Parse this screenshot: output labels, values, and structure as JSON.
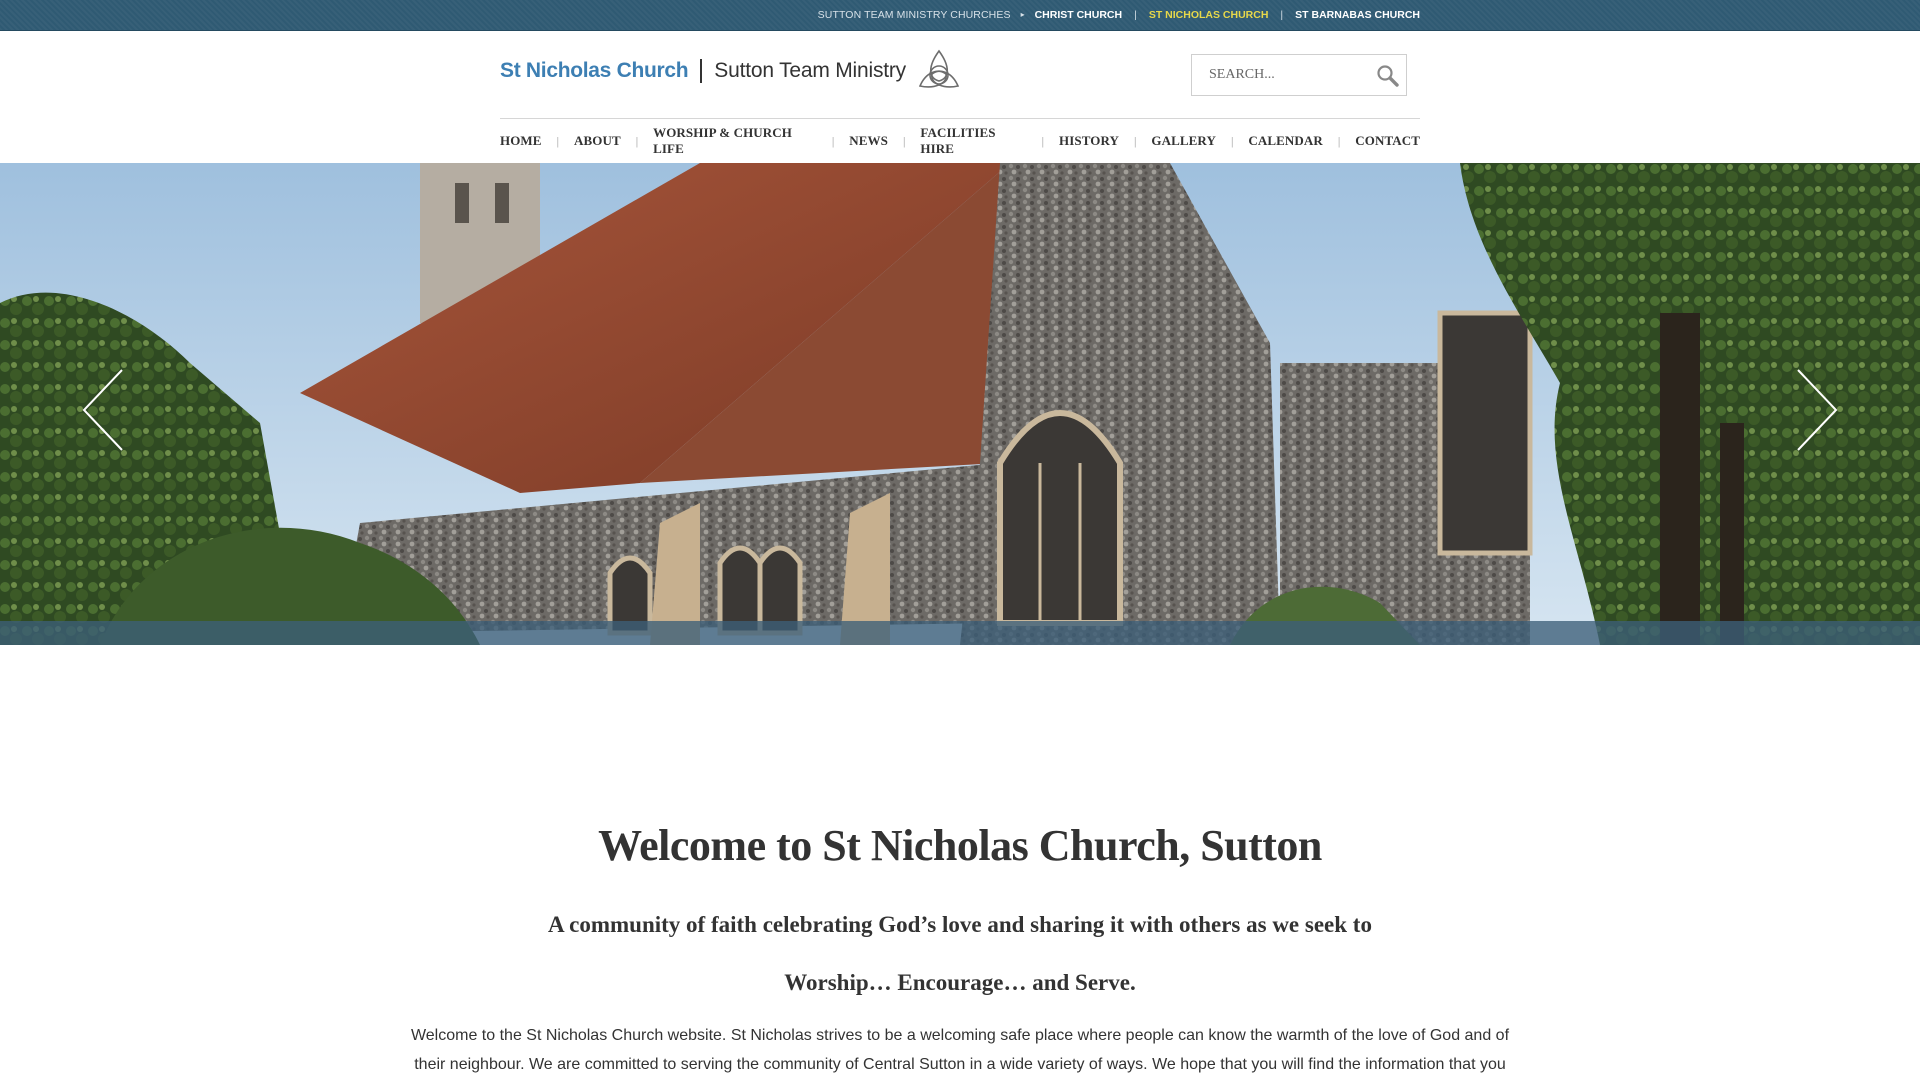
{
  "topbar": {
    "label": "SUTTON TEAM MINISTRY CHURCHES",
    "links": [
      "CHRIST CHURCH",
      "ST NICHOLAS CHURCH",
      "ST BARNABAS CHURCH"
    ],
    "active_color": "#e7d84a"
  },
  "header": {
    "logo_left": "St Nicholas Church",
    "logo_right": "Sutton Team Ministry",
    "logo_icon": "trinity-knot-icon",
    "search_placeholder": "SEARCH...",
    "search_icon": "magnifier-icon"
  },
  "nav": {
    "items": [
      "HOME",
      "ABOUT",
      "WORSHIP & CHURCH LIFE",
      "NEWS",
      "FACILITIES HIRE",
      "HISTORY",
      "GALLERY",
      "CALENDAR",
      "CONTACT"
    ]
  },
  "hero": {
    "prev_icon": "chevron-left-icon",
    "next_icon": "chevron-right-icon"
  },
  "content": {
    "title": "Welcome to St Nicholas Church, Sutton",
    "tagline": "A community of faith celebrating God’s love and sharing it with others as we seek to Worship… Encourage… and Serve.",
    "intro": "Welcome to the St Nicholas Church website. St Nicholas strives to be a welcoming safe place where people can know the warmth of the love of God and of their neighbour. We are committed to serving the community of Central Sutton in a wide variety of ways.  We hope that you will find the information that you"
  },
  "colors": {
    "topbar": "#2f5a73",
    "logo_blue": "#3d7fb3",
    "hero_band": "#3c5f78"
  }
}
